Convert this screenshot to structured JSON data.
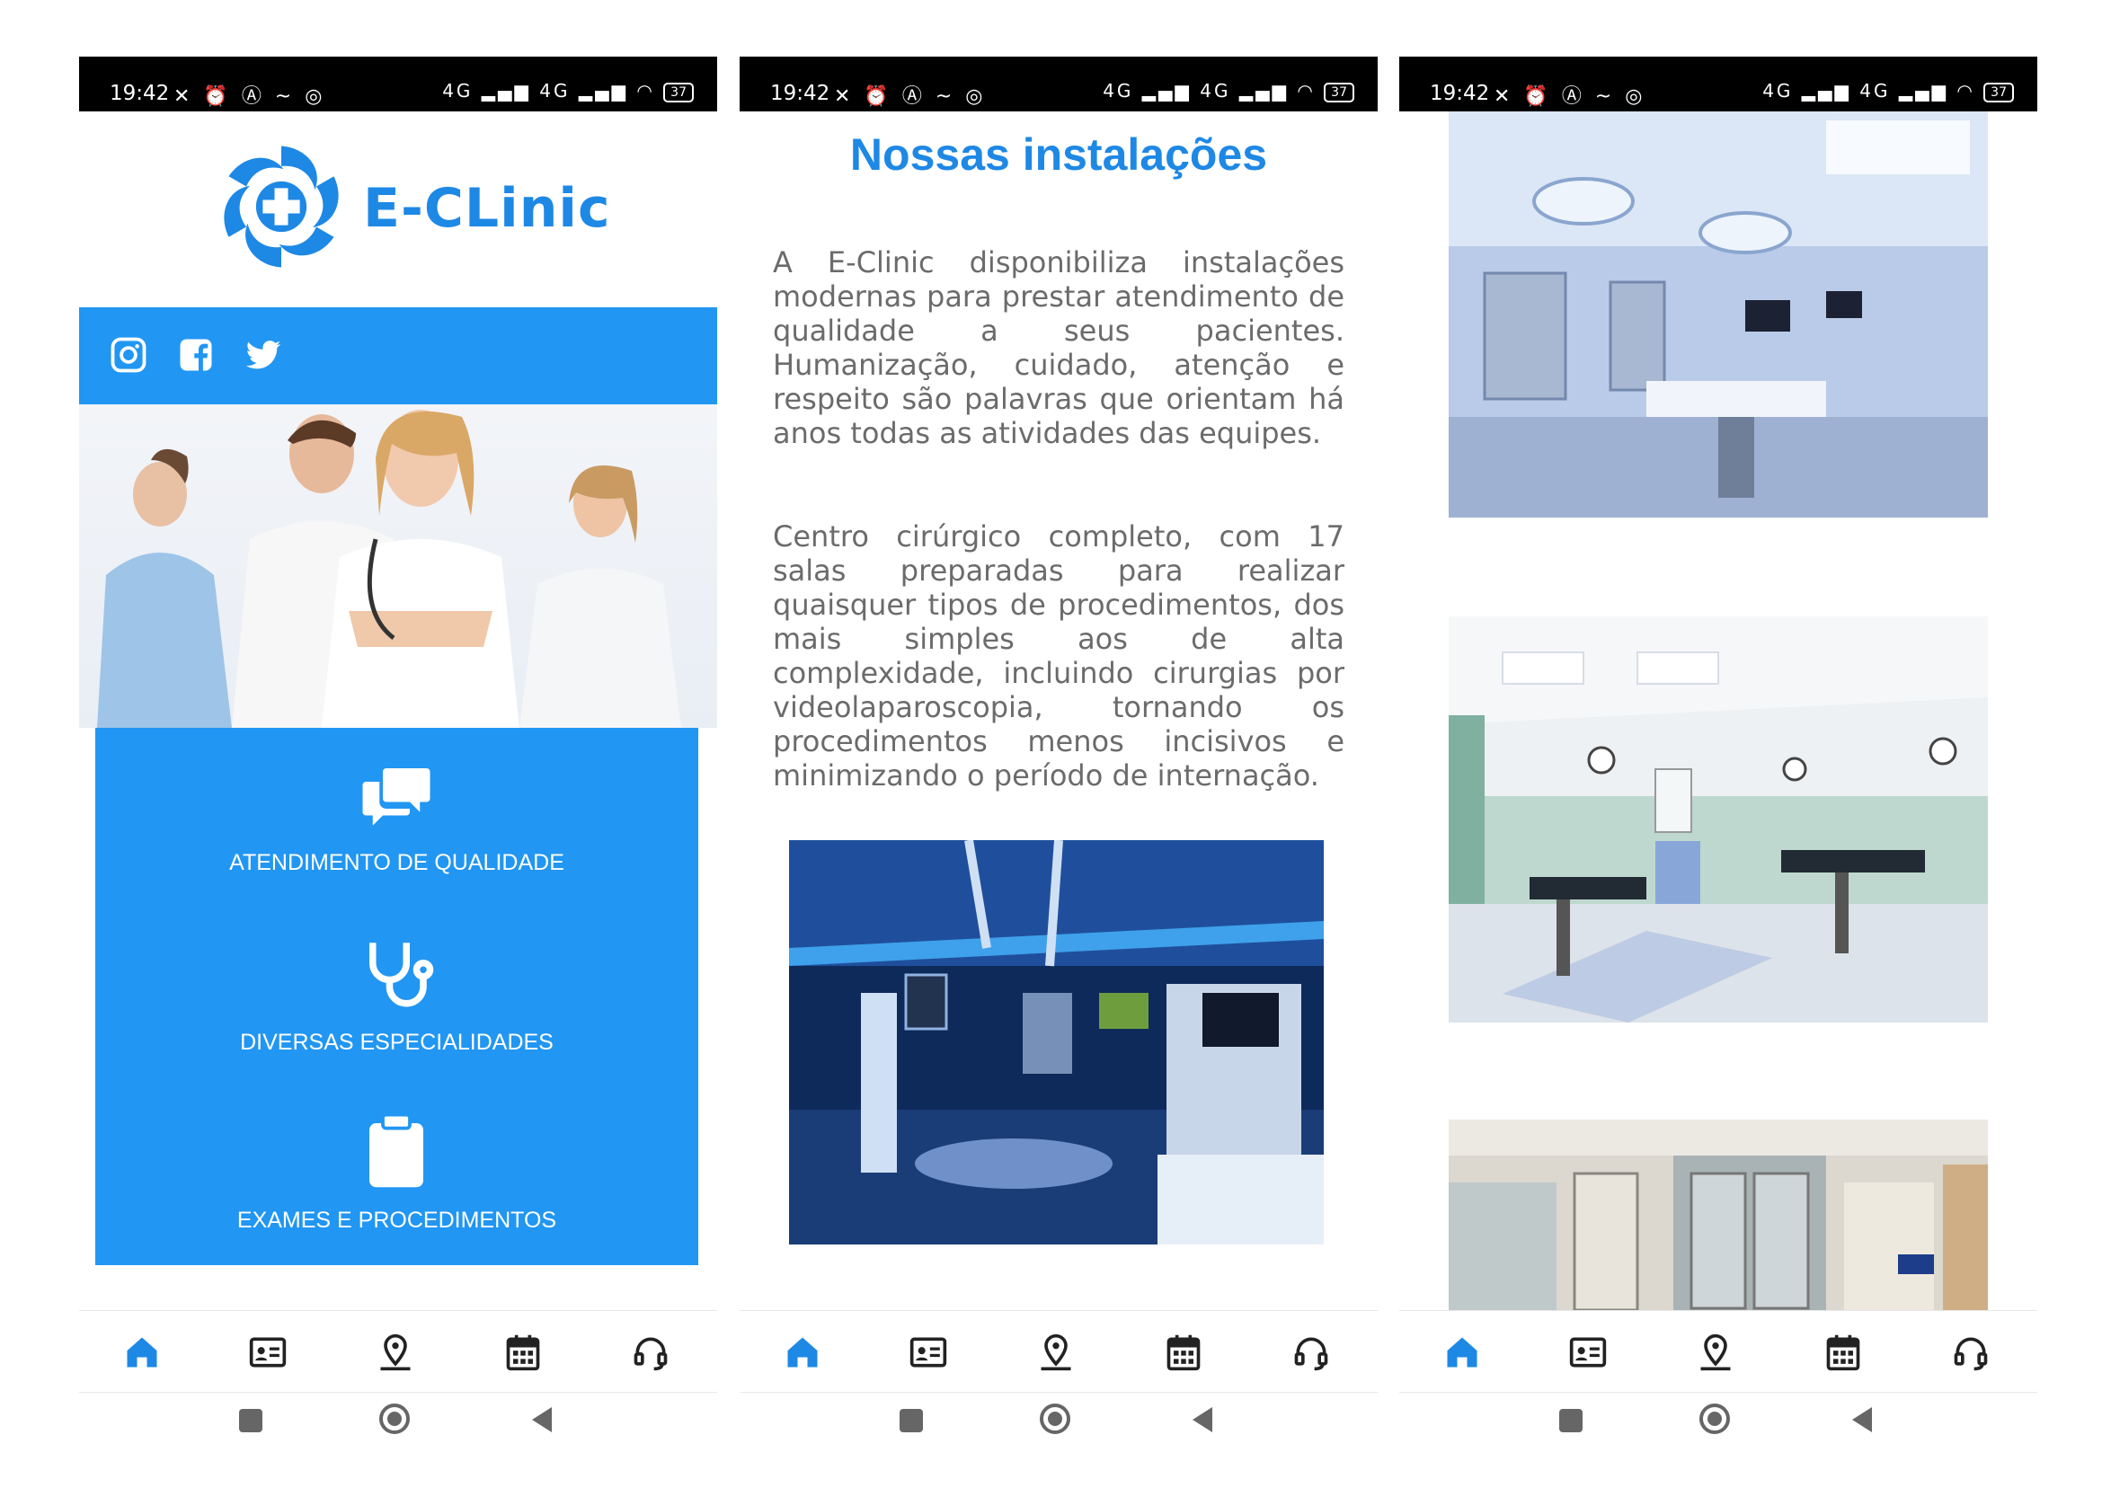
{
  "status_bar": {
    "time": "19:42",
    "battery": "37",
    "left_icons": "✕ ⏰ Ⓐ ~ ◎",
    "right_icons": "4G ▂▄▆ 4G ▂▄▆ ◠"
  },
  "phone1": {
    "logo_text": "E-CLinic",
    "social": [
      "instagram-icon",
      "facebook-icon",
      "twitter-icon"
    ],
    "features": [
      {
        "icon": "chat-bubbles-icon",
        "label": "ATENDIMENTO DE QUALIDADE"
      },
      {
        "icon": "stethoscope-icon",
        "label": "DIVERSAS ESPECIALIDADES"
      },
      {
        "icon": "clipboard-icon",
        "label": "EXAMES E PROCEDIMENTOS"
      }
    ]
  },
  "phone2": {
    "title": "Nossas instalações",
    "paragraph1": "A E-Clinic disponibiliza instalações modernas para prestar atendimento de qualidade a seus pacientes. Humanização, cuidado, atenção e respeito são palavras que orientam há anos todas as atividades das equipes.",
    "paragraph2": "Centro cirúrgico completo, com 17 salas preparadas para realizar quaisquer tipos de procedimentos, dos mais simples aos de alta complexidade, incluindo cirurgias por videolaparoscopia, tornando os procedimentos menos incisivos e minimizando o período de internação."
  },
  "bottom_nav": [
    "home-icon",
    "contact-card-icon",
    "location-pin-icon",
    "calendar-icon",
    "headset-icon"
  ],
  "colors": {
    "primary": "#2196F3",
    "title_blue": "#1E88E5",
    "nav_active": "#1E88E5",
    "text_gray": "#6b6b6b"
  }
}
